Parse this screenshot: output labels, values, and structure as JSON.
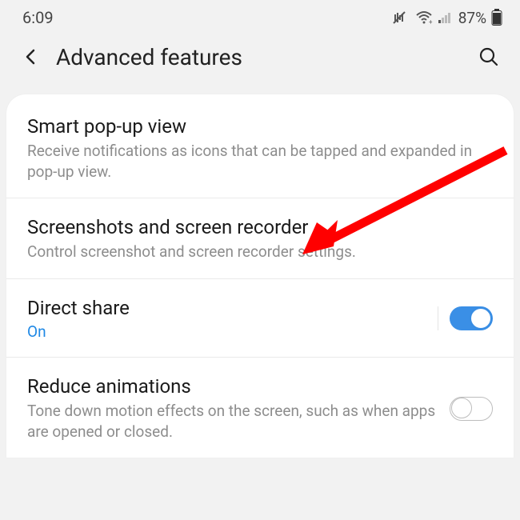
{
  "status": {
    "time": "6:09",
    "battery_pct": "87%"
  },
  "header": {
    "title": "Advanced features"
  },
  "items": {
    "smart_popup": {
      "title": "Smart pop-up view",
      "desc": "Receive notifications as icons that can be tapped and expanded in pop-up view."
    },
    "screenshots": {
      "title": "Screenshots and screen recorder",
      "desc": "Control screenshot and screen recorder settings."
    },
    "direct_share": {
      "title": "Direct share",
      "status": "On"
    },
    "reduce_anim": {
      "title": "Reduce animations",
      "desc": "Tone down motion effects on the screen, such as when apps are opened or closed."
    }
  }
}
